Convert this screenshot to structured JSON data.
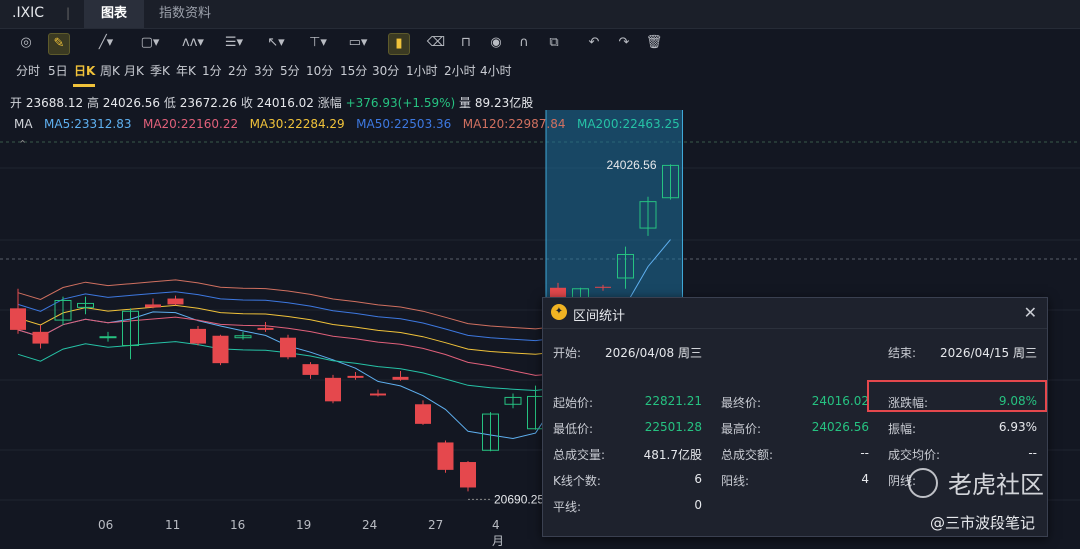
{
  "header": {
    "symbol": ".IXIC",
    "separator": "|",
    "tabs": [
      {
        "label": "图表",
        "active": true
      },
      {
        "label": "指数资料",
        "active": false
      }
    ]
  },
  "toolbar": {
    "tools": [
      "indicator-icon",
      "pencil-icon",
      "line-icon",
      "rect-icon",
      "wave-icon",
      "fib-icon",
      "arrow-icon",
      "vline-icon",
      "text-icon",
      "bar-icon",
      "eraser-icon",
      "lock-icon",
      "eye-icon",
      "magnet-icon",
      "layers-icon",
      "undo-icon",
      "redo-icon",
      "trash-icon"
    ]
  },
  "periods": {
    "items": [
      "分时",
      "5日",
      "日K",
      "周K",
      "月K",
      "季K",
      "年K",
      "1分",
      "2分",
      "3分",
      "5分",
      "10分",
      "15分",
      "30分",
      "1小时",
      "2小时",
      "4小时"
    ],
    "active": "日K"
  },
  "ohlc": {
    "open_label": "开",
    "open": "23688.12",
    "high_label": "高",
    "high": "24026.56",
    "low_label": "低",
    "low": "23672.26",
    "close_label": "收",
    "close": "24016.02",
    "change_label": "涨幅",
    "change": "+376.93(+1.59%)",
    "volume_label": "量",
    "volume": "89.23亿股"
  },
  "ma_legend": [
    {
      "label": "MA",
      "color": "#d0d3d9"
    },
    {
      "label": "MA5:23312.83",
      "color": "#5fb0f0"
    },
    {
      "label": "MA20:22160.22",
      "color": "#e0607a"
    },
    {
      "label": "MA30:22284.29",
      "color": "#f0c23a"
    },
    {
      "label": "MA50:22503.36",
      "color": "#3d78e0"
    },
    {
      "label": "MA120:22987.84",
      "color": "#d07060"
    },
    {
      "label": "MA200:22463.25",
      "color": "#26c2a6"
    }
  ],
  "chart_data": {
    "type": "candlestick",
    "x_labels": [
      "06",
      "11",
      "16",
      "19",
      "24",
      "27",
      "4月"
    ],
    "high_annotation": "24026.56",
    "low_annotation": "20690.25",
    "price_range": [
      20500,
      24300
    ],
    "candles": [
      {
        "o": 22560,
        "h": 22760,
        "l": 22300,
        "c": 22340
      },
      {
        "o": 22320,
        "h": 22390,
        "l": 22150,
        "c": 22200
      },
      {
        "o": 22440,
        "h": 22680,
        "l": 22390,
        "c": 22640
      },
      {
        "o": 22570,
        "h": 22680,
        "l": 22500,
        "c": 22610
      },
      {
        "o": 22260,
        "h": 22320,
        "l": 22220,
        "c": 22270
      },
      {
        "o": 22180,
        "h": 22560,
        "l": 22040,
        "c": 22530
      },
      {
        "o": 22600,
        "h": 22660,
        "l": 22560,
        "c": 22570
      },
      {
        "o": 22660,
        "h": 22690,
        "l": 22590,
        "c": 22600
      },
      {
        "o": 22350,
        "h": 22380,
        "l": 22180,
        "c": 22200
      },
      {
        "o": 22280,
        "h": 22290,
        "l": 21980,
        "c": 22000
      },
      {
        "o": 22260,
        "h": 22320,
        "l": 22240,
        "c": 22280
      },
      {
        "o": 22360,
        "h": 22420,
        "l": 22320,
        "c": 22340
      },
      {
        "o": 22260,
        "h": 22290,
        "l": 22040,
        "c": 22060
      },
      {
        "o": 21990,
        "h": 22010,
        "l": 21840,
        "c": 21880
      },
      {
        "o": 21850,
        "h": 21880,
        "l": 21590,
        "c": 21610
      },
      {
        "o": 21870,
        "h": 21910,
        "l": 21830,
        "c": 21850
      },
      {
        "o": 21690,
        "h": 21730,
        "l": 21660,
        "c": 21670
      },
      {
        "o": 21860,
        "h": 21920,
        "l": 21820,
        "c": 21830
      },
      {
        "o": 21580,
        "h": 21620,
        "l": 21370,
        "c": 21380
      },
      {
        "o": 21190,
        "h": 21210,
        "l": 20880,
        "c": 20910
      },
      {
        "o": 20990,
        "h": 21000,
        "l": 20690,
        "c": 20730
      },
      {
        "o": 21110,
        "h": 21500,
        "l": 21100,
        "c": 21480
      },
      {
        "o": 21580,
        "h": 21690,
        "l": 21540,
        "c": 21650
      },
      {
        "o": 21330,
        "h": 21770,
        "l": 21320,
        "c": 21660
      },
      {
        "o": 22770,
        "h": 22820,
        "l": 22620,
        "c": 22640
      },
      {
        "o": 22520,
        "h": 22770,
        "l": 22500,
        "c": 22760
      },
      {
        "o": 22780,
        "h": 22800,
        "l": 22740,
        "c": 22770
      },
      {
        "o": 22870,
        "h": 23190,
        "l": 22760,
        "c": 23110
      },
      {
        "o": 23380,
        "h": 23700,
        "l": 23300,
        "c": 23650
      },
      {
        "o": 23690,
        "h": 24030,
        "l": 23670,
        "c": 24020
      }
    ]
  },
  "panel": {
    "title": "区间统计",
    "start_label": "开始:",
    "start_value": "2026/04/08 周三",
    "end_label": "结束:",
    "end_value": "2026/04/15 周三",
    "rows": [
      [
        {
          "label": "起始价:",
          "value": "22821.21",
          "color": "g"
        },
        {
          "label": "最终价:",
          "value": "24016.02",
          "color": "g"
        },
        {
          "label": "涨跌幅:",
          "value": "9.08%",
          "color": "g"
        }
      ],
      [
        {
          "label": "最低价:",
          "value": "22501.28",
          "color": "g"
        },
        {
          "label": "最高价:",
          "value": "24026.56",
          "color": "g"
        },
        {
          "label": "振幅:",
          "value": "6.93%",
          "color": "w"
        }
      ],
      [
        {
          "label": "总成交量:",
          "value": "481.7亿股",
          "color": "w"
        },
        {
          "label": "总成交额:",
          "value": "--",
          "color": "w"
        },
        {
          "label": "成交均价:",
          "value": "--",
          "color": "w"
        }
      ],
      [
        {
          "label": "K线个数:",
          "value": "6",
          "color": "w"
        },
        {
          "label": "阳线:",
          "value": "4",
          "color": "w"
        },
        {
          "label": "阴线:",
          "value": "",
          "color": "w"
        }
      ],
      [
        {
          "label": "平线:",
          "value": "0",
          "color": "w"
        },
        {
          "label": "",
          "value": "",
          "color": "w"
        },
        {
          "label": "",
          "value": "",
          "color": "w"
        }
      ]
    ]
  },
  "watermark": {
    "brand": "老虎社区",
    "credit": "@三市波段笔记"
  },
  "colors": {
    "up": "#26c281",
    "down": "#e5484d",
    "selection": "#1e6f9a"
  }
}
